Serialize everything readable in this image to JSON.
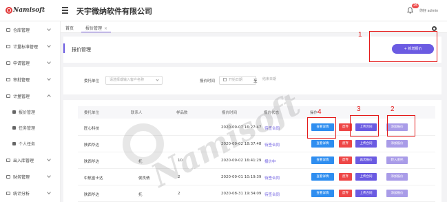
{
  "header": {
    "logo": "Namisoft",
    "company": "天宇微纳软件有限公司",
    "badge": "26",
    "user": "你好 admin"
  },
  "sidebar": {
    "items": [
      {
        "label": "仓库管理"
      },
      {
        "label": "计量标准管理"
      },
      {
        "label": "申请管理"
      },
      {
        "label": "审批管理"
      },
      {
        "label": "计量管理"
      }
    ],
    "sub_items": [
      {
        "label": "报价管理"
      },
      {
        "label": "任务管理"
      },
      {
        "label": "个人任务"
      }
    ],
    "items_after": [
      {
        "label": "出入库管理"
      },
      {
        "label": "财务管理"
      },
      {
        "label": "统计分析"
      }
    ]
  },
  "tabs": [
    {
      "label": "首页"
    },
    {
      "label": "报价管理"
    }
  ],
  "page": {
    "title": "报价管理",
    "add_button": "+ 新增报价"
  },
  "filters": {
    "client_label": "委托单位",
    "client_placeholder": "请选择或输入客户名称",
    "time_label": "报价时间",
    "start_placeholder": "开始日期",
    "separator": "至",
    "end_placeholder": "结束日期"
  },
  "table": {
    "headers": [
      "委托单位",
      "联系人",
      "样品数",
      "报价时间",
      "报价状态",
      "操作"
    ],
    "rows": [
      {
        "client": "匠心科技",
        "contact": "",
        "count": "",
        "time": "2020-09-07 16:27:47",
        "status": "待签合同",
        "buttons": [
          "查看详情",
          "废弃",
          "上传合同",
          "添加报价"
        ]
      },
      {
        "client": "陕西华达",
        "contact": "",
        "count": "",
        "time": "2020-09-02 18:37:48",
        "status": "待签合同",
        "buttons": [
          "查看详情",
          "废弃",
          "上传合同",
          "添加报价"
        ]
      },
      {
        "client": "陕西华达",
        "contact": "托",
        "count": "10",
        "time": "2020-09-02 16:41:29",
        "status": "报价中",
        "buttons": [
          "查看详情",
          "废弃",
          "再次报价",
          "转入委托"
        ]
      },
      {
        "client": "中航富士达",
        "contact": "侯良倩",
        "count": "2",
        "time": "2020-09-01 10:19:39",
        "status": "待签合同",
        "buttons": [
          "查看详情",
          "废弃",
          "上传合同",
          "添加报价"
        ]
      },
      {
        "client": "陕西华达",
        "contact": "托",
        "count": "2",
        "time": "2020-08-31 19:34:09",
        "status": "待签合同",
        "buttons": [
          "查看详情",
          "废弃",
          "上传合同",
          "添加报价"
        ]
      }
    ]
  },
  "annotations": [
    "1",
    "2",
    "3",
    "4"
  ],
  "watermark": "Namisoft",
  "colors": {
    "primary": "#6b5be2",
    "blue": "#2f8ef0",
    "red": "#ee4747",
    "highlight": "#e41a1a"
  }
}
